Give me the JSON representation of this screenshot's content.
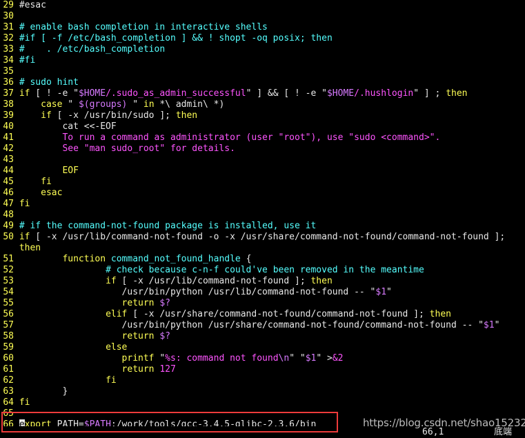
{
  "editor": {
    "lines": [
      {
        "num": "29",
        "segs": [
          {
            "c": "txt",
            "t": "#esac"
          }
        ]
      },
      {
        "num": "30",
        "segs": []
      },
      {
        "num": "31",
        "segs": [
          {
            "c": "cmt",
            "t": "# enable bash completion in interactive shells"
          }
        ]
      },
      {
        "num": "32",
        "segs": [
          {
            "c": "cmt",
            "t": "#if [ -f /etc/bash_completion ] && ! shopt -oq posix; then"
          }
        ]
      },
      {
        "num": "33",
        "segs": [
          {
            "c": "cmt",
            "t": "#    . /etc/bash_completion"
          }
        ]
      },
      {
        "num": "34",
        "segs": [
          {
            "c": "cmt",
            "t": "#fi"
          }
        ]
      },
      {
        "num": "35",
        "segs": []
      },
      {
        "num": "36",
        "segs": [
          {
            "c": "cmt",
            "t": "# sudo hint"
          }
        ]
      },
      {
        "num": "37",
        "segs": [
          {
            "c": "kw",
            "t": "if"
          },
          {
            "c": "txt",
            "t": " [ ! -e \""
          },
          {
            "c": "var",
            "t": "$HOME"
          },
          {
            "c": "str",
            "t": "/.sudo_as_admin_successful"
          },
          {
            "c": "txt",
            "t": "\" ] && [ ! -e \""
          },
          {
            "c": "var",
            "t": "$HOME"
          },
          {
            "c": "str",
            "t": "/.hushlogin"
          },
          {
            "c": "txt",
            "t": "\" ] ; "
          },
          {
            "c": "kw",
            "t": "then"
          }
        ]
      },
      {
        "num": "38",
        "segs": [
          {
            "c": "txt",
            "t": "    "
          },
          {
            "c": "kw",
            "t": "case"
          },
          {
            "c": "txt",
            "t": " \" "
          },
          {
            "c": "var",
            "t": "$(groups)"
          },
          {
            "c": "txt",
            "t": " \" "
          },
          {
            "c": "kw",
            "t": "in"
          },
          {
            "c": "txt",
            "t": " *\\ admin\\ *)"
          }
        ]
      },
      {
        "num": "39",
        "segs": [
          {
            "c": "txt",
            "t": "    "
          },
          {
            "c": "kw",
            "t": "if"
          },
          {
            "c": "txt",
            "t": " [ -x /usr/bin/sudo ]; "
          },
          {
            "c": "kw",
            "t": "then"
          }
        ]
      },
      {
        "num": "40",
        "segs": [
          {
            "c": "txt",
            "t": "        cat <<-EOF"
          }
        ]
      },
      {
        "num": "41",
        "segs": [
          {
            "c": "txt",
            "t": "        "
          },
          {
            "c": "str",
            "t": "To run a command as administrator (user \"root\"), use \"sudo <command>\"."
          }
        ]
      },
      {
        "num": "42",
        "segs": [
          {
            "c": "txt",
            "t": "        "
          },
          {
            "c": "str",
            "t": "See \"man sudo_root\" for details."
          }
        ]
      },
      {
        "num": "43",
        "segs": []
      },
      {
        "num": "44",
        "segs": [
          {
            "c": "txt",
            "t": "        "
          },
          {
            "c": "kw",
            "t": "EOF"
          }
        ]
      },
      {
        "num": "45",
        "segs": [
          {
            "c": "txt",
            "t": "    "
          },
          {
            "c": "kw",
            "t": "fi"
          }
        ]
      },
      {
        "num": "46",
        "segs": [
          {
            "c": "txt",
            "t": "    "
          },
          {
            "c": "kw",
            "t": "esac"
          }
        ]
      },
      {
        "num": "47",
        "segs": [
          {
            "c": "kw",
            "t": "fi"
          }
        ]
      },
      {
        "num": "48",
        "segs": []
      },
      {
        "num": "49",
        "segs": [
          {
            "c": "cmt",
            "t": "# if the command-not-found package is installed, use it"
          }
        ]
      },
      {
        "num": "50",
        "segs": [
          {
            "c": "kw",
            "t": "if"
          },
          {
            "c": "txt",
            "t": " [ -x /usr/lib/command-not-found -o -x /usr/share/command-not-found/command-not-found ];"
          }
        ]
      },
      {
        "num": "",
        "segs": [
          {
            "c": "kw",
            "t": "then"
          }
        ]
      },
      {
        "num": "51",
        "segs": [
          {
            "c": "txt",
            "t": "        "
          },
          {
            "c": "kw",
            "t": "function"
          },
          {
            "c": "txt",
            "t": " "
          },
          {
            "c": "cmt",
            "t": "command_not_found_handle"
          },
          {
            "c": "txt",
            "t": " {"
          }
        ]
      },
      {
        "num": "52",
        "segs": [
          {
            "c": "txt",
            "t": "                "
          },
          {
            "c": "cmt",
            "t": "# check because c-n-f could've been removed in the meantime"
          }
        ]
      },
      {
        "num": "53",
        "segs": [
          {
            "c": "txt",
            "t": "                "
          },
          {
            "c": "kw",
            "t": "if"
          },
          {
            "c": "txt",
            "t": " [ -x /usr/lib/command-not-found ]; "
          },
          {
            "c": "kw",
            "t": "then"
          }
        ]
      },
      {
        "num": "54",
        "segs": [
          {
            "c": "txt",
            "t": "                   /usr/bin/python /usr/lib/command-not-found -- \""
          },
          {
            "c": "var",
            "t": "$1"
          },
          {
            "c": "txt",
            "t": "\""
          }
        ]
      },
      {
        "num": "55",
        "segs": [
          {
            "c": "txt",
            "t": "                   "
          },
          {
            "c": "kw",
            "t": "return"
          },
          {
            "c": "txt",
            "t": " "
          },
          {
            "c": "var",
            "t": "$?"
          }
        ]
      },
      {
        "num": "56",
        "segs": [
          {
            "c": "txt",
            "t": "                "
          },
          {
            "c": "kw",
            "t": "elif"
          },
          {
            "c": "txt",
            "t": " [ -x /usr/share/command-not-found/command-not-found ]; "
          },
          {
            "c": "kw",
            "t": "then"
          }
        ]
      },
      {
        "num": "57",
        "segs": [
          {
            "c": "txt",
            "t": "                   /usr/bin/python /usr/share/command-not-found/command-not-found -- \""
          },
          {
            "c": "var",
            "t": "$1"
          },
          {
            "c": "txt",
            "t": "\""
          }
        ]
      },
      {
        "num": "58",
        "segs": [
          {
            "c": "txt",
            "t": "                   "
          },
          {
            "c": "kw",
            "t": "return"
          },
          {
            "c": "txt",
            "t": " "
          },
          {
            "c": "var",
            "t": "$?"
          }
        ]
      },
      {
        "num": "59",
        "segs": [
          {
            "c": "txt",
            "t": "                "
          },
          {
            "c": "kw",
            "t": "else"
          }
        ]
      },
      {
        "num": "60",
        "segs": [
          {
            "c": "txt",
            "t": "                   "
          },
          {
            "c": "kw",
            "t": "printf"
          },
          {
            "c": "txt",
            "t": " \""
          },
          {
            "c": "str",
            "t": "%s: command not found"
          },
          {
            "c": "var",
            "t": "\\n"
          },
          {
            "c": "txt",
            "t": "\" \""
          },
          {
            "c": "var",
            "t": "$1"
          },
          {
            "c": "txt",
            "t": "\" >"
          },
          {
            "c": "str",
            "t": "&2"
          }
        ]
      },
      {
        "num": "61",
        "segs": [
          {
            "c": "txt",
            "t": "                   "
          },
          {
            "c": "kw",
            "t": "return"
          },
          {
            "c": "txt",
            "t": " "
          },
          {
            "c": "str",
            "t": "127"
          }
        ]
      },
      {
        "num": "62",
        "segs": [
          {
            "c": "txt",
            "t": "                "
          },
          {
            "c": "kw",
            "t": "fi"
          }
        ]
      },
      {
        "num": "63",
        "segs": [
          {
            "c": "txt",
            "t": "        }"
          }
        ]
      },
      {
        "num": "64",
        "segs": [
          {
            "c": "kw",
            "t": "fi"
          }
        ]
      },
      {
        "num": "65",
        "segs": []
      },
      {
        "num": "66",
        "segs": [
          {
            "c": "cursor",
            "t": "e"
          },
          {
            "c": "kw",
            "t": "xport"
          },
          {
            "c": "txt",
            "t": " PATH="
          },
          {
            "c": "var",
            "t": "$PATH"
          },
          {
            "c": "txt",
            "t": ":/work/tools/gcc-3.4.5-glibc-2.3.6/bin"
          }
        ]
      }
    ]
  },
  "status": {
    "position": "66,1",
    "scroll": "底端"
  },
  "watermark": "https://blog.csdn.net/shao15232",
  "colors": {
    "line_number": "#ffff55",
    "comment": "#55ffff",
    "keyword": "#ffff55",
    "string": "#ff55ff",
    "variable": "#d77aff",
    "highlight_box": "#ee3b3b"
  }
}
